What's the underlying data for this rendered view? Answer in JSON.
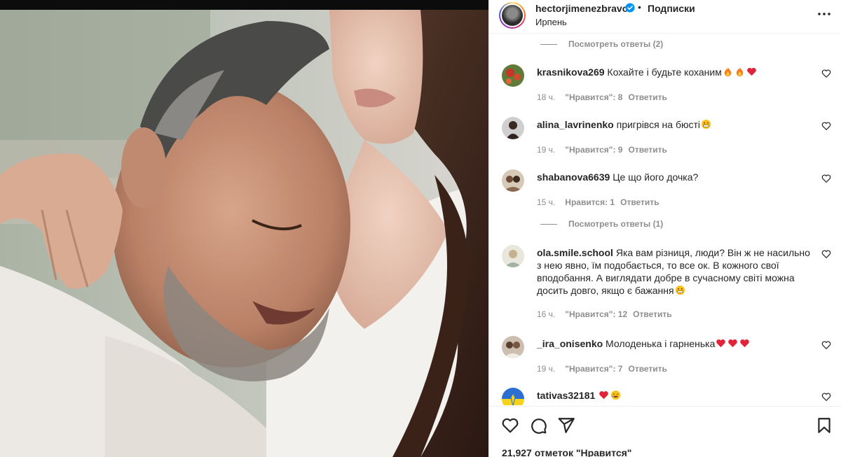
{
  "post": {
    "username": "hectorjimenezbravo",
    "follow_label": "Подписки",
    "separator": "•",
    "location": "Ирпень",
    "likes_text": "21,927 отметок \"Нравится\""
  },
  "view_replies": [
    {
      "label": "Посмотреть ответы (2)"
    },
    {
      "label": "Посмотреть ответы (1)"
    }
  ],
  "comments": [
    {
      "user": "krasnikova269",
      "text": "Кохайте і будьте коханим",
      "emojis": [
        "fire-emoji",
        "fire-emoji",
        "heart-emoji"
      ],
      "time": "18 ч.",
      "likes": "\"Нравится\": 8",
      "reply": "Ответить"
    },
    {
      "user": "alina_lavrinenko",
      "text": "пригрівся на бюсті",
      "emojis": [
        "grin-emoji"
      ],
      "time": "19 ч.",
      "likes": "\"Нравится\": 9",
      "reply": "Ответить"
    },
    {
      "user": "shabanova6639",
      "text": "Це що його дочка?",
      "emojis": [],
      "time": "15 ч.",
      "likes": "Нравится: 1",
      "reply": "Ответить"
    },
    {
      "user": "ola.smile.school",
      "text": "Яка вам різниця, люди? Він ж не насильно з нею явно, їм подобається, то все ок. В кожного свої вподобання. А виглядати добре в сучасному світі можна досить довго, якщо є бажання",
      "emojis": [
        "grin-emoji"
      ],
      "time": "16 ч.",
      "likes": "\"Нравится\": 12",
      "reply": "Ответить"
    },
    {
      "user": "_ira_onisenko",
      "text": "Молоденька і гарненька",
      "emojis": [
        "heart-emoji",
        "heart-emoji",
        "heart-emoji"
      ],
      "time": "19 ч.",
      "likes": "\"Нравится\": 7",
      "reply": "Ответить"
    },
    {
      "user": "tativas32181",
      "text": "",
      "emojis": [
        "heart-emoji",
        "laugh-emoji"
      ],
      "time": "",
      "likes": "",
      "reply": ""
    }
  ],
  "icons": {
    "like": "heart-outline-icon",
    "comment": "comment-bubble-icon",
    "share": "paper-plane-icon",
    "save": "bookmark-icon",
    "more": "more-dots-icon",
    "verified": "verified-badge-icon"
  },
  "colors": {
    "verified": "#0095f6",
    "meta_text": "#8e8e8e",
    "heart": "#e0243a",
    "fire": "#f77b1b"
  }
}
